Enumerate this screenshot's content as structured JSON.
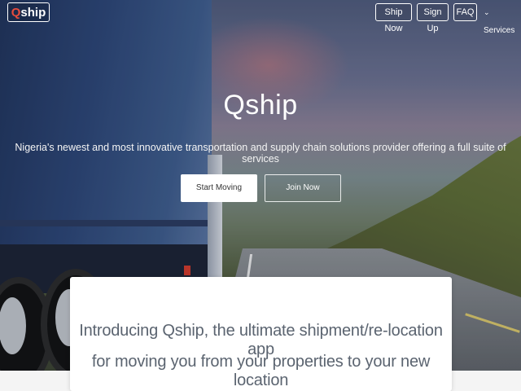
{
  "brand": {
    "logo_q": "Q",
    "logo_rest": "ship"
  },
  "nav": {
    "ship_now": "Ship Now",
    "sign_up": "Sign Up",
    "faq": "FAQ",
    "services": "Services"
  },
  "hero": {
    "title": "Qship",
    "tagline": "Nigeria's newest and most innovative transportation and supply chain solutions provider offering a full suite of services",
    "start_button": "Start Moving",
    "join_button": "Join Now"
  },
  "intro": {
    "line1": "Introducing Qship, the ultimate shipment/re-location app",
    "line2": "for moving you from your properties to your new location"
  },
  "colors": {
    "logo_accent": "#e74c3c",
    "hero_overlay": "#2c4575"
  },
  "icons": {
    "services_toggle": "chevron-down-icon"
  }
}
